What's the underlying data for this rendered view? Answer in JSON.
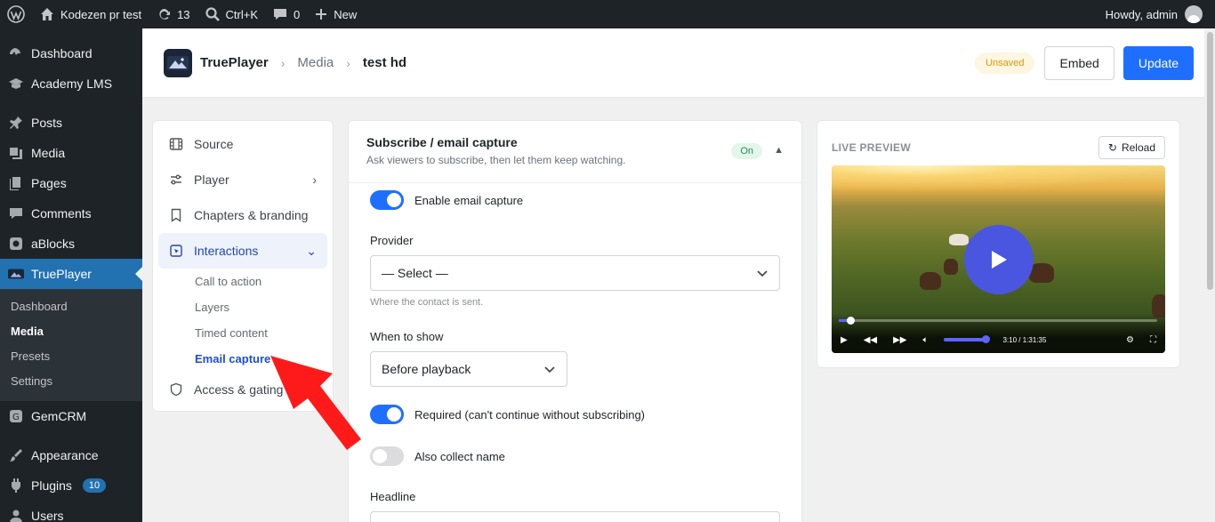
{
  "adminbar": {
    "site_name": "Kodezen pr test",
    "updates_count": "13",
    "search_shortcut": "Ctrl+K",
    "comments_count": "0",
    "new_label": "New",
    "howdy": "Howdy, admin"
  },
  "wp_menu": {
    "items": [
      {
        "label": "Dashboard",
        "icon": "dashboard-icon"
      },
      {
        "label": "Academy LMS",
        "icon": "academy-icon"
      },
      {
        "label": "Posts",
        "icon": "pin-icon"
      },
      {
        "label": "Media",
        "icon": "media-icon"
      },
      {
        "label": "Pages",
        "icon": "pages-icon"
      },
      {
        "label": "Comments",
        "icon": "comments-icon"
      },
      {
        "label": "aBlocks",
        "icon": "ablocks-icon"
      },
      {
        "label": "TruePlayer",
        "icon": "trueplayer-icon"
      }
    ],
    "submenu": [
      "Dashboard",
      "Media",
      "Presets",
      "Settings"
    ],
    "submenu_current": "Media",
    "after": [
      {
        "label": "GemCRM",
        "icon": "gemcrm-icon"
      },
      {
        "label": "Appearance",
        "icon": "brush-icon"
      },
      {
        "label": "Plugins",
        "icon": "plugin-icon",
        "badge": "10"
      },
      {
        "label": "Users",
        "icon": "users-icon"
      }
    ]
  },
  "header": {
    "brand": "TruePlayer",
    "crumb_media": "Media",
    "crumb_current": "test hd",
    "unsaved": "Unsaved",
    "embed": "Embed",
    "update": "Update"
  },
  "nav": {
    "source": "Source",
    "player": "Player",
    "chapters": "Chapters & branding",
    "interactions": "Interactions",
    "sub": [
      "Call to action",
      "Layers",
      "Timed content",
      "Email capture"
    ],
    "sub_current": "Email capture",
    "access": "Access & gating"
  },
  "form": {
    "title": "Subscribe / email capture",
    "subtitle": "Ask viewers to subscribe, then let them keep watching.",
    "status": "On",
    "enable_label": "Enable email capture",
    "enable_on": true,
    "provider_label": "Provider",
    "provider_value": "— Select —",
    "provider_help": "Where the contact is sent.",
    "when_label": "When to show",
    "when_value": "Before playback",
    "required_label": "Required (can't continue without subscribing)",
    "required_on": true,
    "collect_name_label": "Also collect name",
    "collect_name_on": false,
    "headline_label": "Headline"
  },
  "preview": {
    "title": "LIVE PREVIEW",
    "reload": "Reload",
    "time": "3:10 / 1:31:35",
    "progress_fraction": 0.035
  },
  "colors": {
    "primary": "#1e6fff",
    "wp_dark": "#1d2327",
    "wp_active": "#2271b1",
    "annotation": "#ff0000"
  }
}
